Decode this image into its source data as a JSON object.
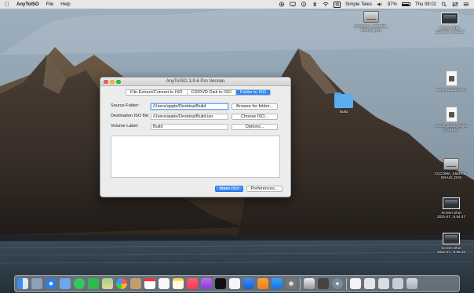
{
  "menubar": {
    "app_name": "AnyToISO",
    "menus": [
      "File",
      "Help"
    ],
    "vpn_label": "Simple Teles",
    "battery_percent": "87%",
    "clock": "Thu 09:02"
  },
  "desktop": {
    "icons": [
      {
        "label": "CCCOMA_X64FRE_\nEN-US_DV9",
        "kind": "disk-icon"
      },
      {
        "label": "Screen Shot\n2021-07...8.54.28",
        "kind": "screenshot-icon"
      },
      {
        "label": "Windows11x64.iso",
        "kind": "file-icon"
      },
      {
        "label": "Build",
        "kind": "folder-icon"
      },
      {
        "label": "Win10_21H1_Englis\nh_x64.iso",
        "kind": "file-icon"
      },
      {
        "label": "CCCOMA_X64FRE_\nEN-US_DV9",
        "kind": "disk-icon"
      },
      {
        "label": "Screen Shot\n2021-07...8.54.47",
        "kind": "screenshot-icon"
      },
      {
        "label": "Screen Shot\n2021-07...8.55.40",
        "kind": "screenshot-icon"
      }
    ]
  },
  "window": {
    "title": "AnyToISO 3.9.6 Pro Version",
    "tabs": [
      "File Extract/Convert to ISO",
      "CD/DVD Disk to ISO",
      "Folder to ISO"
    ],
    "active_tab": 2,
    "source_label": "Source Folder:",
    "source_value": "/Users/apple/Desktop/Build",
    "browse_button": "Browse for folder...",
    "destination_label": "Destination ISO file:",
    "destination_value": "/Users/apple/Desktop/Build.iso",
    "choose_button": "Choose ISO...",
    "volume_label": "Volume Label:",
    "volume_value": "Build",
    "options_button": "Options...",
    "make_iso_button": "Make ISO",
    "preferences_button": "Preferences..."
  },
  "dock": {
    "apps": [
      "finder-icon",
      "launchpad-icon",
      "safari-icon",
      "photos-preview-icon",
      "messages-icon",
      "facetime-icon",
      "maps-icon",
      "photos-icon",
      "contacts-icon",
      "calendar-icon",
      "reminders-icon",
      "notes-icon",
      "music-icon",
      "podcasts-icon",
      "tv-icon",
      "numbers-icon",
      "keynote-icon",
      "pages-icon",
      "app-store-icon",
      "system-preferences-icon",
      "anytoiso-icon",
      "utility-icon",
      "preview-icon",
      "downloads-stack-icon",
      "documents-stack-icon",
      "trash-icon"
    ],
    "accent": "#2f86f6"
  }
}
